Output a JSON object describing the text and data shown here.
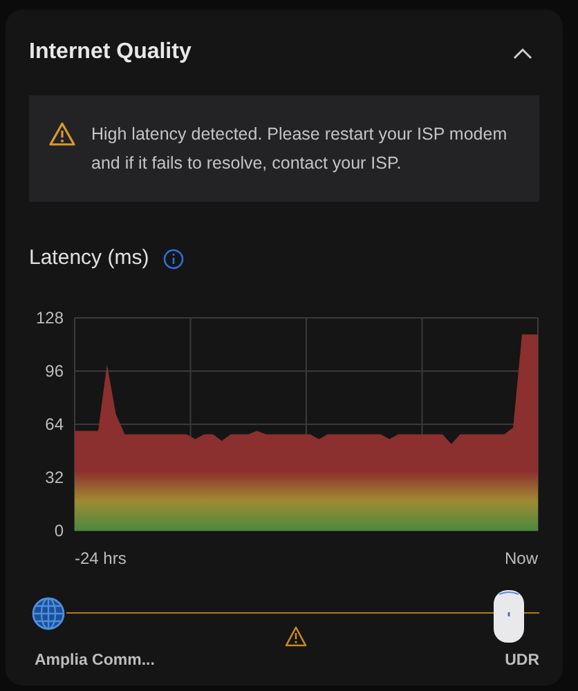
{
  "card": {
    "title": "Internet Quality",
    "expanded": true
  },
  "alert": {
    "message": "High latency detected. Please restart your ISP modem and if it fails to resolve, contact your ISP."
  },
  "latency": {
    "title": "Latency (ms)",
    "chart_data": {
      "type": "area",
      "grid": true,
      "ylim": [
        0,
        128
      ],
      "yticks": [
        0,
        32,
        64,
        96,
        128
      ],
      "categories": [
        "-24 hrs",
        null,
        null,
        null,
        null,
        null,
        null,
        null,
        null,
        null,
        null,
        null,
        null,
        null,
        null,
        null,
        null,
        null,
        null,
        null,
        null,
        null,
        null,
        null,
        null,
        null,
        null,
        null,
        null,
        null,
        null,
        null,
        null,
        null,
        null,
        null,
        null,
        null,
        null,
        null,
        null,
        null,
        null,
        null,
        null,
        null,
        null,
        null,
        "Now"
      ],
      "series": [
        {
          "color": "#8c2f2f",
          "values": [
            60,
            100,
            70,
            58,
            58,
            58,
            58,
            58,
            58,
            58,
            58,
            55,
            58,
            58,
            54,
            58,
            58,
            58,
            60,
            58,
            58,
            58,
            58,
            58,
            58,
            55,
            58,
            58,
            58,
            58,
            58,
            58,
            58,
            55,
            58,
            58,
            58,
            58,
            58,
            58,
            52,
            58,
            58,
            58,
            58,
            58,
            58,
            62,
            118
          ]
        }
      ]
    }
  },
  "connection": {
    "source": "Amplia Comm...",
    "device": "UDR",
    "warning": true
  }
}
